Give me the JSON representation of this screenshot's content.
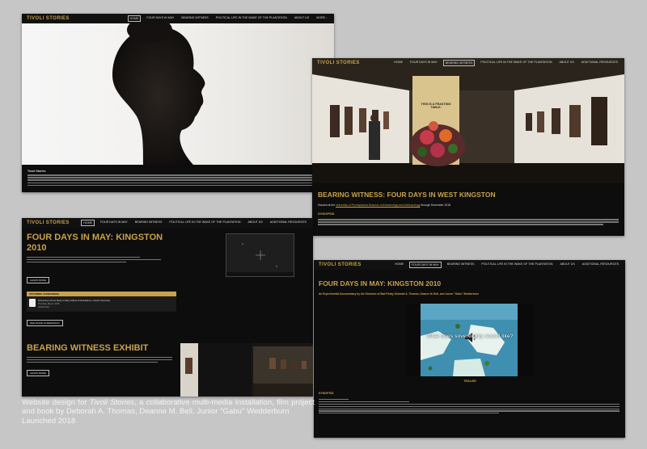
{
  "brand": "TIVOLI STORIES",
  "nav": [
    "HOME",
    "FOUR DAYS IN MAY",
    "BEARING WITNESS",
    "POLITICAL LIFE IN THE WAKE OF THE PLANTATION",
    "ABOUT US",
    "ADDITIONAL RESOURCES"
  ],
  "nav_more": "MORE...",
  "home": {
    "intro_lead": "Tivoli Stories"
  },
  "exhibit": {
    "slide_title": "THIS IS A FEASTING TABLE.",
    "heading": "BEARING WITNESS: FOUR DAYS IN WEST KINGSTON",
    "housed_prefix": "Housed at the",
    "housed_link": "University of Pennsylvania Museum of Archaeology and Anthropology",
    "housed_suffix": "through December 2018",
    "synopsis": "SYNOPSIS"
  },
  "landing": {
    "title": "FOUR DAYS IN MAY: KINGSTON 2010",
    "learn_more": "LEARN MORE",
    "upcoming": "UPCOMING SCREENINGS",
    "event_title": "Screening of Four Days in May at Race & Resistance, Oxford University",
    "event_date": "Thursday, May 9, 2019",
    "event_place": "Oxford (UK)",
    "see_more": "SEE MORE SCREENINGS",
    "bw_title": "BEARING WITNESS EXHIBIT",
    "learn_more2": "LEARN MORE"
  },
  "film": {
    "title": "FOUR DAYS IN MAY: KINGSTON 2010",
    "subtitle": "An Experimental Documentary by the Directors of Bad Friday Deborah A. Thomas, Deanne M. Bell, and Junior \"Gabu\" Wedderburn",
    "video_caption": "What does sovereignty sound like?",
    "trailer": "TRAILER",
    "synopsis": "SYNOPSIS"
  },
  "caption": {
    "pre": "Website design for ",
    "italic": "Tivoli Stories",
    "post": ", a collaborative multi-media installation, film project and book by Deborah A. Thomas, Deanne M. Bell, Junior \"Gabu\" Wedderburn",
    "launched": "Launched 2018"
  }
}
